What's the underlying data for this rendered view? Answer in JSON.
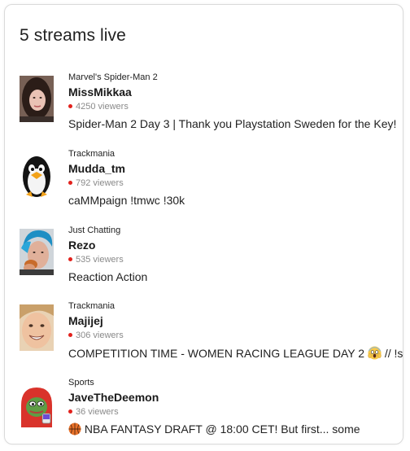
{
  "header": {
    "title": "5 streams live"
  },
  "streams": [
    {
      "game": "Marvel's Spider-Man 2",
      "streamer": "MissMikkaa",
      "viewers": "4250 viewers",
      "title": "Spider-Man 2 Day 3 | Thank you Playstation Sweden for the Key!"
    },
    {
      "game": "Trackmania",
      "streamer": "Mudda_tm",
      "viewers": "792 viewers",
      "title": "caMMpaign !tmwc !30k"
    },
    {
      "game": "Just Chatting",
      "streamer": "Rezo",
      "viewers": "535 viewers",
      "title": "Reaction Action"
    },
    {
      "game": "Trackmania",
      "streamer": "Majijej",
      "viewers": "306 viewers",
      "title_before_emoji": "COMPETITION TIME - WOMEN RACING LEAGUE DAY 2 ",
      "title_after_emoji": " // !s",
      "title_emoji": "scream-emoji"
    },
    {
      "game": "Sports",
      "streamer": "JaveTheDeemon",
      "viewers": "36 viewers",
      "title_emoji": "basketball-emoji",
      "title_after_emoji": " NBA FANTASY DRAFT @ 18:00 CET! But first... some"
    }
  ],
  "colors": {
    "live_dot": "#e2211c",
    "muted_text": "#8a8a8a",
    "border": "#dadada"
  }
}
